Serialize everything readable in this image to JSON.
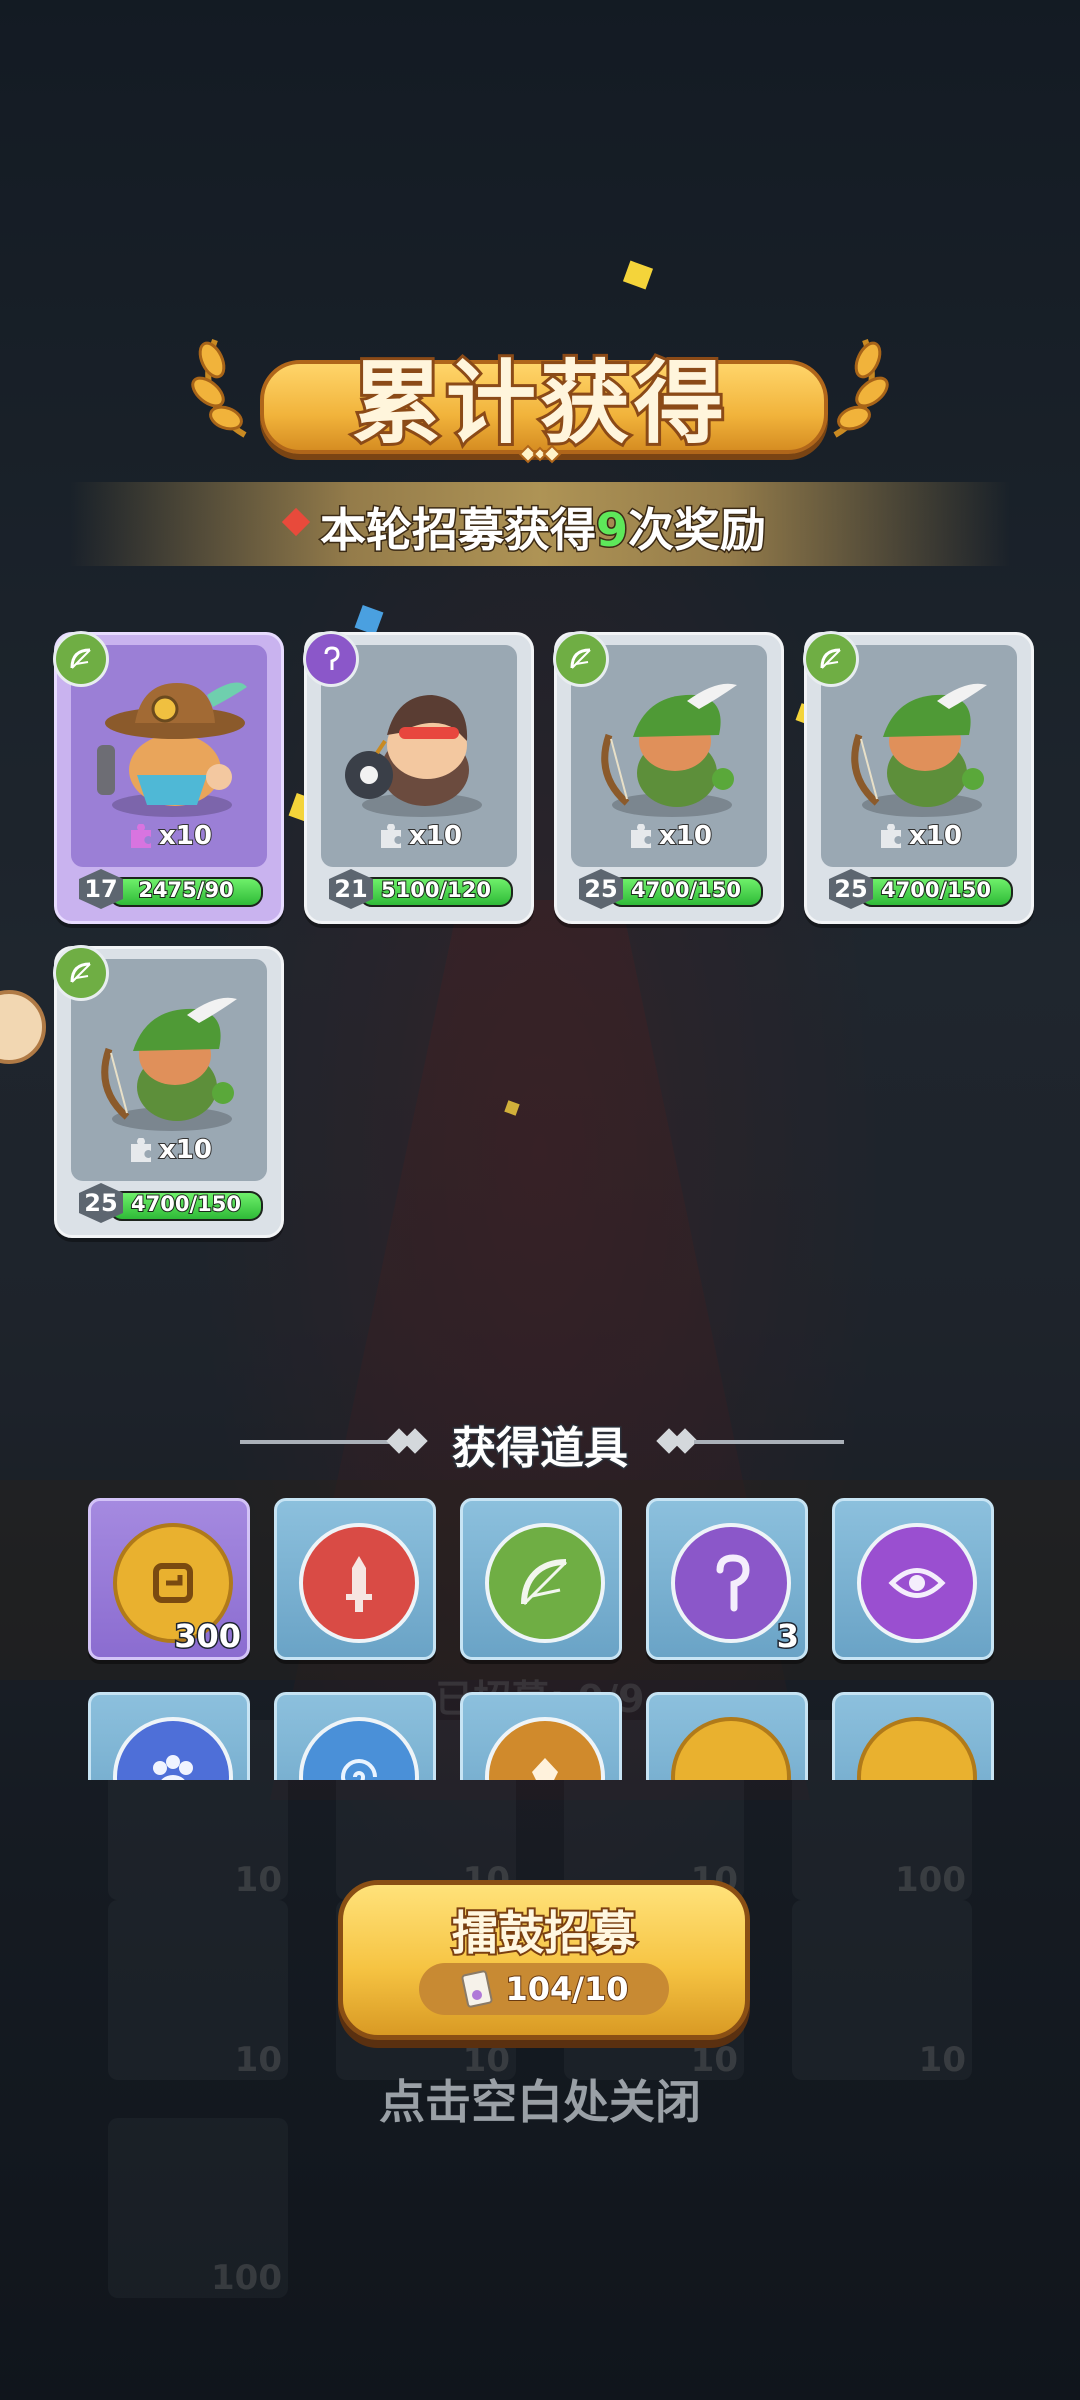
{
  "banner": {
    "title": "累计获得"
  },
  "ribbon": {
    "prefix": "本轮招募获得",
    "count": "9",
    "suffix": "次奖励"
  },
  "hero_cards": [
    {
      "class": "archer",
      "rarity": "purple",
      "fragments": "x10",
      "level": "17",
      "progress": "2475/90"
    },
    {
      "class": "mage",
      "rarity": "gray",
      "fragments": "x10",
      "level": "21",
      "progress": "5100/120"
    },
    {
      "class": "archer",
      "rarity": "gray",
      "fragments": "x10",
      "level": "25",
      "progress": "4700/150"
    },
    {
      "class": "archer",
      "rarity": "gray",
      "fragments": "x10",
      "level": "25",
      "progress": "4700/150"
    },
    {
      "class": "archer",
      "rarity": "gray",
      "fragments": "x10",
      "level": "25",
      "progress": "4700/150"
    }
  ],
  "items_section": {
    "title": "获得道具"
  },
  "items_row1": [
    {
      "icon": "gold-coin-icon",
      "count": "300",
      "color": "#e9b12f"
    },
    {
      "icon": "sword-orb-icon",
      "count": "",
      "color": "#d94b45"
    },
    {
      "icon": "bow-orb-icon",
      "count": "",
      "color": "#6fae44"
    },
    {
      "icon": "mage-orb-icon",
      "count": "3",
      "color": "#8b57c9"
    },
    {
      "icon": "eye-orb-icon",
      "count": "",
      "color": "#9a4fd0"
    }
  ],
  "items_row2": [
    {
      "icon": "paw-orb-icon",
      "color": "#4e6fd8"
    },
    {
      "icon": "swirl-orb-icon",
      "color": "#4a90d8"
    },
    {
      "icon": "crest-orb-icon",
      "color": "#d08a2c"
    },
    {
      "icon": "gold-coin-icon",
      "color": "#e9b12f"
    },
    {
      "icon": "gold-coin-icon",
      "color": "#e9b12f"
    }
  ],
  "background": {
    "recruited_label": "已招募: 9/9",
    "ghost_counts": [
      "10",
      "10",
      "10",
      "100",
      "10",
      "10",
      "10",
      "10",
      "100"
    ]
  },
  "recruit_button": {
    "label": "擂鼓招募",
    "cost": "104/10"
  },
  "close_hint": "点击空白处关闭"
}
